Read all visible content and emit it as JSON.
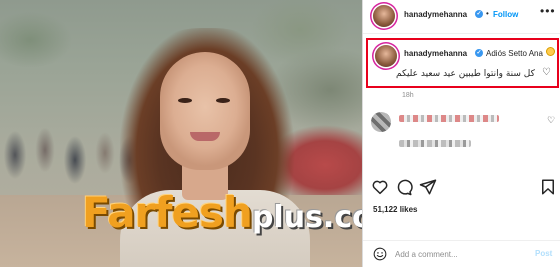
{
  "post": {
    "username": "hanadymehanna",
    "follow_label": "Follow",
    "more_label": "•••",
    "separator": "•",
    "verified_mark": "✓"
  },
  "photo": {
    "watermark_main": "Farfesh",
    "watermark_sub": "plus.com"
  },
  "caption": {
    "username": "hanadymehanna",
    "inline_text": "Adiós Setto Ana",
    "emoji": "smiling-face-emoji",
    "arabic_text": "كل سنة وانتوا طيبين عيد سعيد عليكم",
    "heart_icon": "♡",
    "time": "18h"
  },
  "comments": {
    "heart_icon": "♡"
  },
  "stats": {
    "likes": "51,122 likes"
  },
  "add_comment": {
    "placeholder": "Add a comment...",
    "post_label": "Post"
  },
  "colors": {
    "accent_blue": "#0095f6",
    "highlight_red": "#e8001c",
    "watermark_orange": "#f0a020",
    "verified_blue": "#3897f0"
  }
}
